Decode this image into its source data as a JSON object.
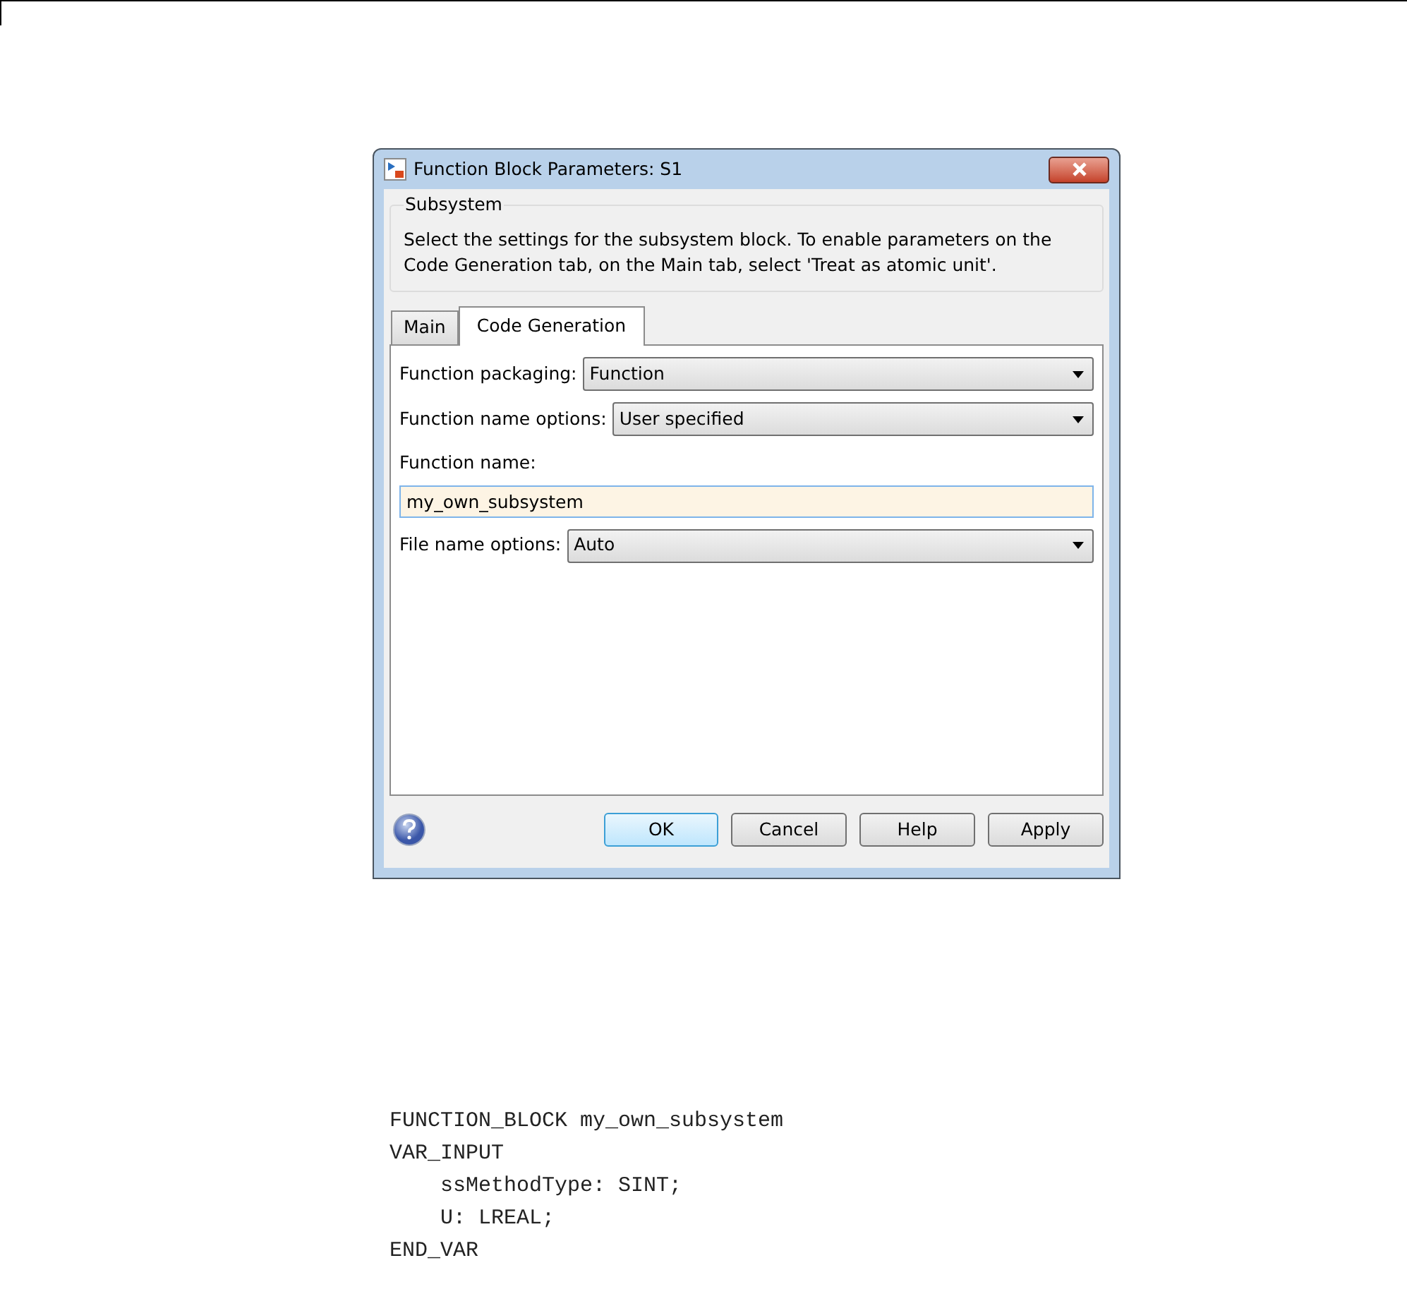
{
  "dialog": {
    "title": "Function Block Parameters: S1",
    "group": {
      "title": "Subsystem",
      "description": "Select the settings for the subsystem block. To enable parameters on the Code Generation tab, on the Main tab, select 'Treat as atomic unit'."
    },
    "tabs": [
      {
        "label": "Main",
        "selected": false
      },
      {
        "label": "Code Generation",
        "selected": true
      }
    ],
    "fields": [
      {
        "kind": "dropdown",
        "label": "Function packaging:",
        "value": "Function"
      },
      {
        "kind": "dropdown",
        "label": "Function name options:",
        "value": "User specified"
      },
      {
        "kind": "text",
        "label": "Function name:",
        "value": "my_own_subsystem"
      },
      {
        "kind": "dropdown",
        "label": "File name options:",
        "value": "Auto"
      }
    ],
    "buttons": [
      {
        "label": "OK",
        "default": true
      },
      {
        "label": "Cancel",
        "default": false
      },
      {
        "label": "Help",
        "default": false
      },
      {
        "label": "Apply",
        "default": false
      }
    ]
  },
  "code": [
    "FUNCTION_BLOCK my_own_subsystem",
    "VAR_INPUT",
    "    ssMethodType: SINT;",
    "    U: LREAL;",
    "END_VAR"
  ]
}
